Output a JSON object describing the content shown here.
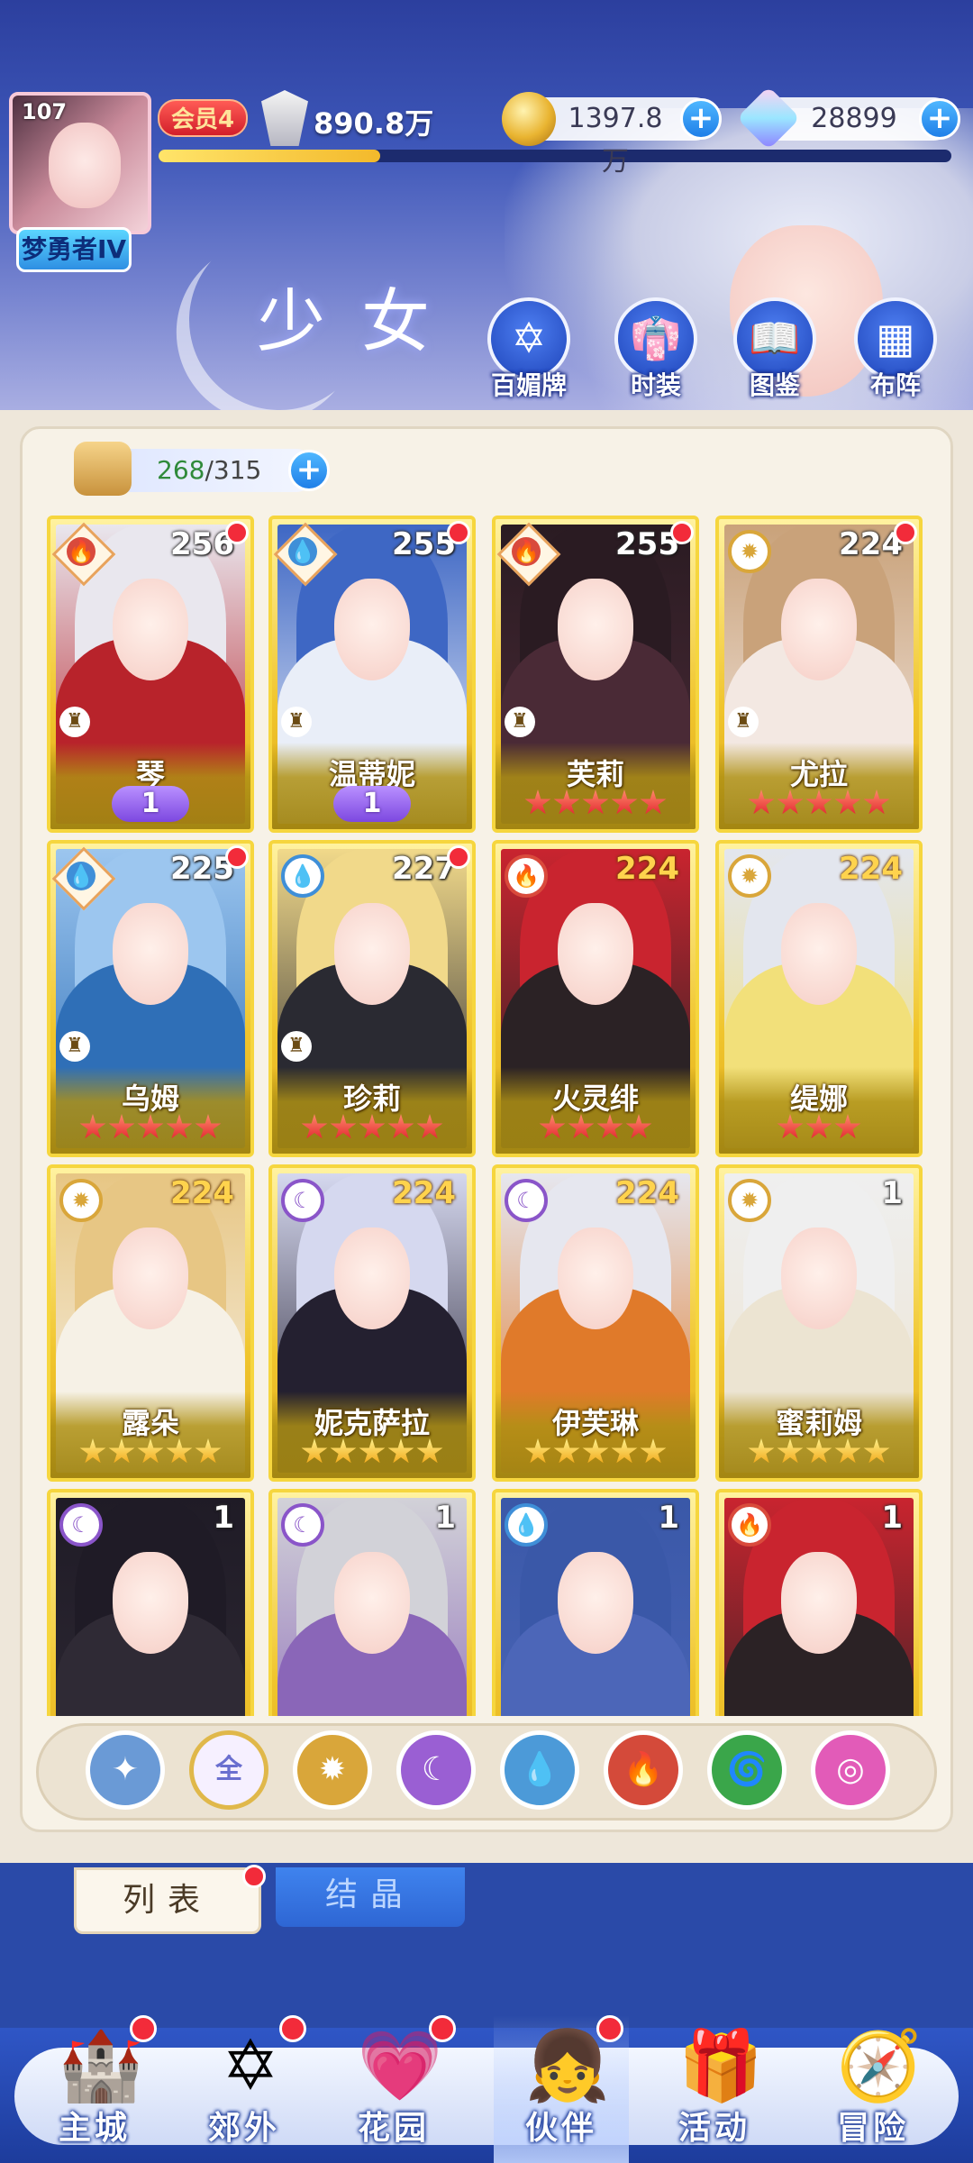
{
  "header": {
    "title": "少女",
    "player_level": "107",
    "rank": "梦勇者IV",
    "vip": "会员4",
    "power": "890.8万",
    "xp_progress": 0.28,
    "gold": "1397.8万",
    "gems": "28899"
  },
  "menu": [
    {
      "label": "百媚牌",
      "icon": "card-icon"
    },
    {
      "label": "时装",
      "icon": "dress-icon"
    },
    {
      "label": "图鉴",
      "icon": "book-icon"
    },
    {
      "label": "布阵",
      "icon": "formation-icon"
    }
  ],
  "roster": {
    "owned": "268",
    "total": "/315"
  },
  "cards": [
    {
      "name": "琴",
      "level": "256",
      "element": "fire",
      "elem_shape": "diamond",
      "class_icon": true,
      "dot": true,
      "awaken": "1",
      "stars": 0,
      "star_color": "red",
      "hair": "#e9e7ee",
      "body": "#b8232b"
    },
    {
      "name": "温蒂妮",
      "level": "255",
      "element": "water",
      "elem_shape": "diamond",
      "class_icon": true,
      "dot": true,
      "awaken": "1",
      "stars": 0,
      "star_color": "red",
      "hair": "#3e67c4",
      "body": "#e9eef8"
    },
    {
      "name": "芙莉",
      "level": "255",
      "element": "fire",
      "elem_shape": "diamond",
      "class_icon": true,
      "dot": true,
      "stars": 5,
      "star_color": "red",
      "hair": "#2a1b22",
      "body": "#4a2a36"
    },
    {
      "name": "尤拉",
      "level": "224",
      "element": "light",
      "elem_shape": "circle",
      "class_icon": true,
      "dot": true,
      "stars": 5,
      "star_color": "red",
      "hair": "#c9a27a",
      "body": "#f3e8e2"
    },
    {
      "name": "乌姆",
      "level": "225",
      "element": "water",
      "elem_shape": "diamond",
      "class_icon": true,
      "dot": true,
      "stars": 5,
      "star_color": "red",
      "hair": "#9cc6ef",
      "body": "#2f6fb7"
    },
    {
      "name": "珍莉",
      "level": "227",
      "element": "water",
      "elem_shape": "circle",
      "class_icon": true,
      "dot": true,
      "stars": 5,
      "star_color": "red",
      "hair": "#f1d98a",
      "body": "#2a2a32"
    },
    {
      "name": "火灵绯",
      "level": "224",
      "element": "fire",
      "elem_shape": "circle",
      "class_icon": false,
      "dot": false,
      "level_style": "orange",
      "stars": 4,
      "star_color": "red",
      "hair": "#c9242f",
      "body": "#2b2225"
    },
    {
      "name": "缇娜",
      "level": "224",
      "element": "light",
      "elem_shape": "circle",
      "class_icon": false,
      "dot": false,
      "level_style": "orange",
      "stars": 3,
      "star_color": "red",
      "hair": "#e3e6ee",
      "body": "#f2e07a"
    },
    {
      "name": "露朵",
      "level": "224",
      "element": "light",
      "elem_shape": "circle",
      "class_icon": false,
      "dot": false,
      "level_style": "orange",
      "stars": 5,
      "star_color": "gold",
      "hair": "#e7c684",
      "body": "#f6f1e6"
    },
    {
      "name": "妮克萨拉",
      "level": "224",
      "element": "dark",
      "elem_shape": "circle",
      "class_icon": false,
      "dot": false,
      "level_style": "orange",
      "stars": 5,
      "star_color": "gold",
      "hair": "#d5d8ef",
      "body": "#242030"
    },
    {
      "name": "伊芙琳",
      "level": "224",
      "element": "dark",
      "elem_shape": "circle",
      "class_icon": false,
      "dot": false,
      "level_style": "orange",
      "stars": 5,
      "star_color": "gold",
      "hair": "#e6e7ef",
      "body": "#e07a2a"
    },
    {
      "name": "蜜莉姆",
      "level": "1",
      "element": "light",
      "elem_shape": "circle",
      "class_icon": false,
      "dot": false,
      "stars": 5,
      "star_color": "gold",
      "hair": "#efefef",
      "body": "#ece4d2"
    },
    {
      "name": "",
      "level": "1",
      "element": "dark",
      "elem_shape": "circle",
      "class_icon": false,
      "dot": false,
      "stars": 0,
      "hair": "#1f1b26",
      "body": "#2f2a35"
    },
    {
      "name": "",
      "level": "1",
      "element": "dark",
      "elem_shape": "circle",
      "class_icon": false,
      "dot": false,
      "stars": 0,
      "hair": "#d2d2d8",
      "body": "#8a66b8"
    },
    {
      "name": "",
      "level": "1",
      "element": "water",
      "elem_shape": "circle",
      "class_icon": false,
      "dot": false,
      "stars": 0,
      "hair": "#3a58a8",
      "body": "#4c66b8"
    },
    {
      "name": "",
      "level": "1",
      "element": "fire",
      "elem_shape": "circle",
      "class_icon": false,
      "dot": false,
      "stars": 0,
      "hair": "#c9242f",
      "body": "#2b2225"
    }
  ],
  "filters": [
    {
      "id": "filter-special",
      "label": "",
      "glyph": "✦",
      "color": "#6a9ad6"
    },
    {
      "id": "filter-all",
      "label": "全",
      "glyph": "全",
      "color": "#f6f0ff",
      "text": "#6a6fcf"
    },
    {
      "id": "filter-light",
      "label": "",
      "glyph": "✹",
      "color": "#d9a63a"
    },
    {
      "id": "filter-dark",
      "label": "",
      "glyph": "☾",
      "color": "#9a5fd3"
    },
    {
      "id": "filter-water",
      "label": "",
      "glyph": "💧",
      "color": "#4c9ad8"
    },
    {
      "id": "filter-fire",
      "label": "",
      "glyph": "🔥",
      "color": "#d44a3a"
    },
    {
      "id": "filter-wind",
      "label": "",
      "glyph": "🌀",
      "color": "#3aa64a"
    },
    {
      "id": "filter-spirit",
      "label": "",
      "glyph": "◎",
      "color": "#e25bb8"
    }
  ],
  "tabs": {
    "list": "列表",
    "crystal": "结晶"
  },
  "nav": [
    {
      "label": "主城",
      "icon": "castle-icon",
      "dot": true
    },
    {
      "label": "郊外",
      "icon": "portal-icon",
      "dot": true
    },
    {
      "label": "花园",
      "icon": "heart-icon",
      "dot": true
    },
    {
      "label": "伙伴",
      "icon": "partner-icon",
      "dot": true,
      "active": true
    },
    {
      "label": "活动",
      "icon": "gift-icon",
      "dot": false
    },
    {
      "label": "冒险",
      "icon": "compass-icon",
      "dot": false
    }
  ],
  "colors": {
    "accent": "#2e66d4",
    "card_gold": "#f0c52d",
    "badge_red": "#f22b3a"
  }
}
